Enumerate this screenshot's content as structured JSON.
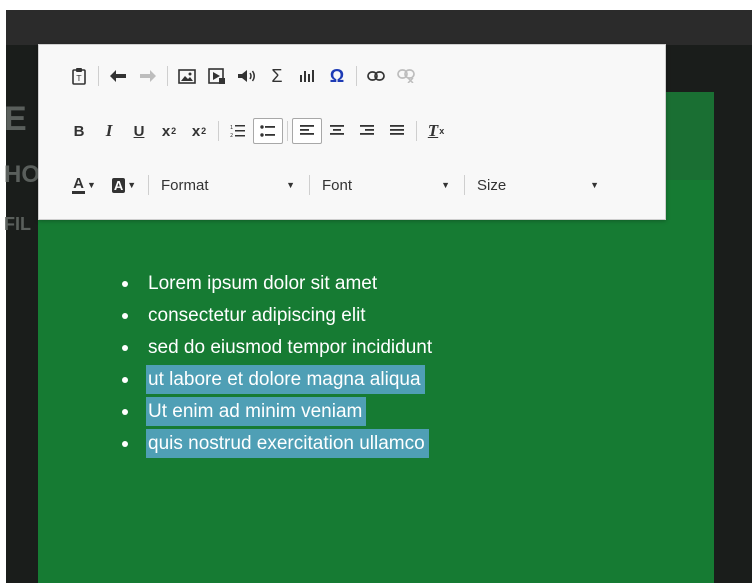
{
  "toolbar": {
    "row1": [
      {
        "name": "paste-text-icon",
        "label": ""
      },
      {
        "name": "undo-icon",
        "label": ""
      },
      {
        "name": "redo-icon",
        "label": "",
        "disabled": true
      },
      {
        "name": "image-icon",
        "label": ""
      },
      {
        "name": "video-icon",
        "label": ""
      },
      {
        "name": "audio-icon",
        "label": ""
      },
      {
        "name": "math-sigma-icon",
        "label": "Σ"
      },
      {
        "name": "chart-icon",
        "label": ""
      },
      {
        "name": "special-char-icon",
        "label": "Ω"
      },
      {
        "name": "link-icon",
        "label": ""
      },
      {
        "name": "unlink-icon",
        "label": "",
        "disabled": true
      }
    ],
    "format": {
      "bold": "B",
      "italic": "I",
      "underline": "U",
      "subscript": "x",
      "superscript": "x",
      "remove_format": "T"
    },
    "format_combo": "Format",
    "font_combo": "Font",
    "size_combo": "Size",
    "text_color": "A",
    "bg_color": "A"
  },
  "background": {
    "line1": "E",
    "line2": "HO",
    "line3": "FIL"
  },
  "content": {
    "items": [
      {
        "text": "Lorem ipsum dolor sit amet",
        "selected": false
      },
      {
        "text": "consectetur adipiscing elit",
        "selected": false
      },
      {
        "text": "sed do eiusmod tempor incididunt",
        "selected": false
      },
      {
        "text": "ut labore et dolore magna aliqua",
        "selected": true
      },
      {
        "text": "Ut enim ad minim veniam",
        "selected": true
      },
      {
        "text": "quis nostrud exercitation ullamco",
        "selected": true
      }
    ]
  },
  "colors": {
    "panel_green": "#167b33",
    "selection": "#4f9fb5",
    "omega_blue": "#1d3bb5"
  }
}
